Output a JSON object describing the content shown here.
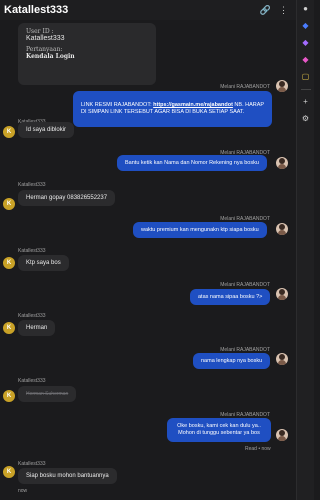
{
  "header": {
    "title": "Katallest333"
  },
  "prechat": {
    "user_id_label": "User ID :",
    "user_id_value": "Katallest333",
    "question_label": "Pertanyaan:",
    "question_value": "Kendala Login"
  },
  "agent_name": "Melani RAJABANDOT",
  "user_name": "Katallest333",
  "user_initial": "K",
  "messages": {
    "m1": {
      "pre": "LINK RESMI RAJABANDOT: ",
      "link": "https://gasmain.me/rajabandot",
      "post": " NB. HARAP DI SIMPAN LINK TERSEBUT AGAR BISA DI BUKA SETIAP SAAT."
    },
    "m2": "Id saya diblokir",
    "m3": "Bantu ketik kan Nama dan Nomor Rekening nya bosku",
    "m4": "Herman gopay 083826552237",
    "m5": "waktu premium kan mengunakn ktp siapa bosku",
    "m6": "Ktp saya bos",
    "m7": "atas nama sipaa bosku ?>",
    "m8": "Herman",
    "m9": "nama lengkap nya bosku",
    "m10": "Herman Suherman",
    "m11": "Oke bosku, kami cek kan dulu ya.. Mohon di tunggu sebentar ya bos",
    "m12": "Siap bosku mohon bantuannya"
  },
  "meta": {
    "read": "Read • now",
    "now": "now"
  },
  "colors": {
    "accent": "#1f4fc2",
    "avatar": "#c9a227",
    "bg": "#1b1b1d"
  }
}
